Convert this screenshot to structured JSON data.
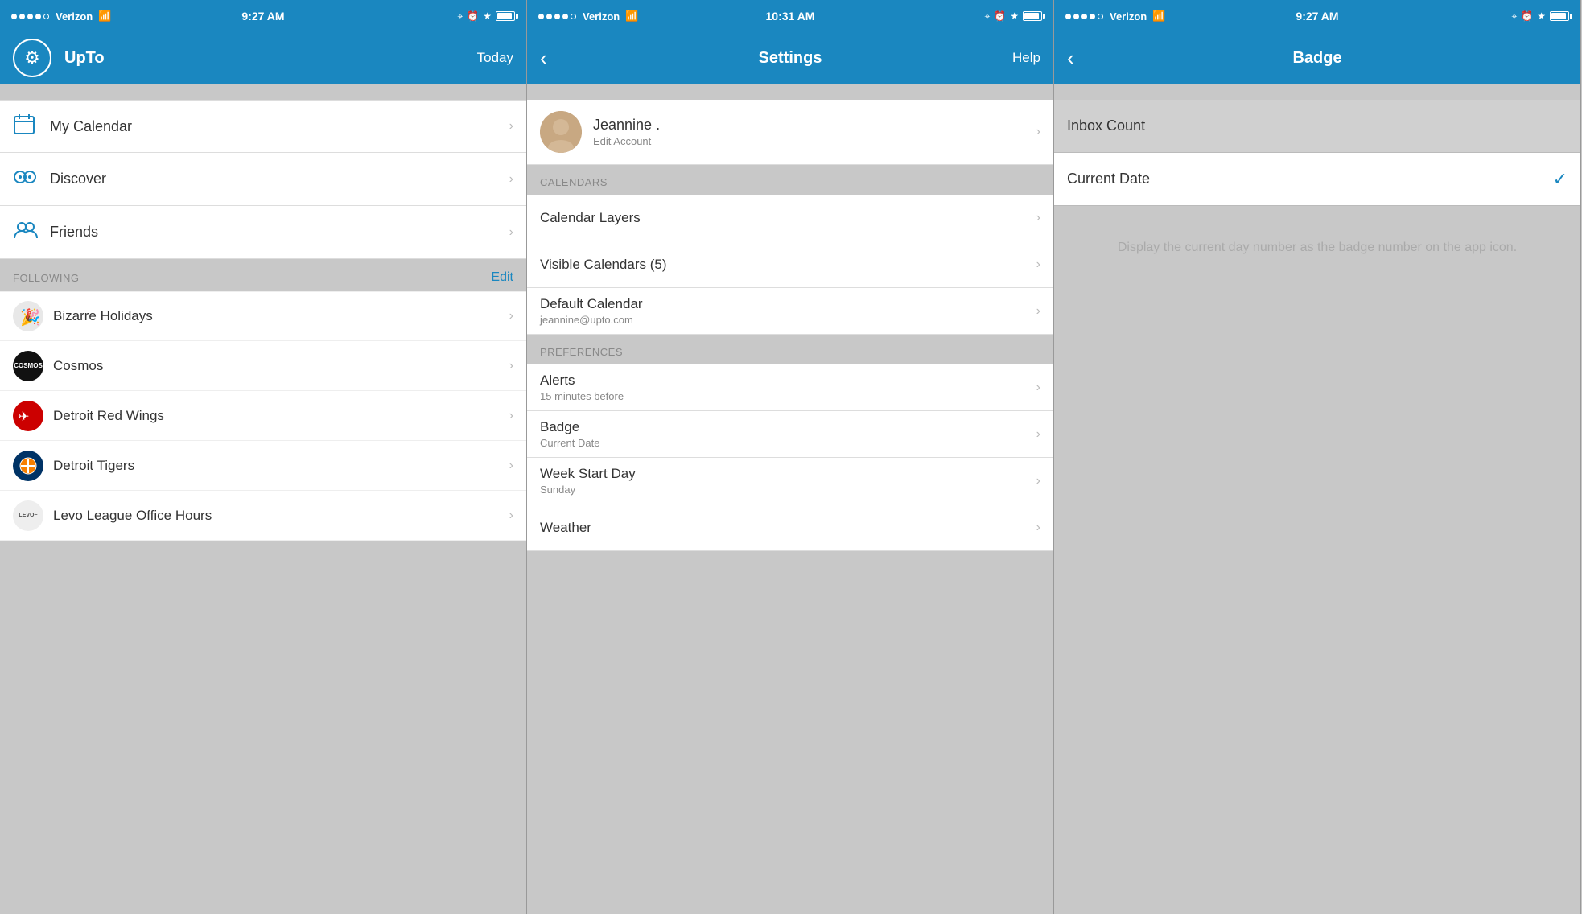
{
  "panel1": {
    "statusBar": {
      "carrier": "Verizon",
      "time": "9:27 AM",
      "dots": [
        true,
        true,
        true,
        true,
        true
      ],
      "dotsEmpty": [
        false
      ]
    },
    "navBar": {
      "title": "UpTo",
      "rightLabel": "Today",
      "gearIcon": "⚙"
    },
    "menuItems": [
      {
        "label": "My Calendar",
        "icon": "calendar"
      },
      {
        "label": "Discover",
        "icon": "discover"
      },
      {
        "label": "Friends",
        "icon": "friends"
      }
    ],
    "followingHeader": "FOLLOWING",
    "editLabel": "Edit",
    "followingItems": [
      {
        "label": "Bizarre Holidays",
        "avatarType": "holidays"
      },
      {
        "label": "Cosmos",
        "avatarType": "cosmos",
        "avatarText": "COSMOS"
      },
      {
        "label": "Detroit Red Wings",
        "avatarType": "detroit-rw"
      },
      {
        "label": "Detroit Tigers",
        "avatarType": "detroit-t"
      },
      {
        "label": "Levo League Office Hours",
        "avatarType": "levo",
        "avatarText": "LEVO"
      }
    ]
  },
  "panel2": {
    "statusBar": {
      "carrier": "Verizon",
      "time": "10:31 AM"
    },
    "navBar": {
      "title": "Settings",
      "rightLabel": "Help",
      "backIcon": "‹"
    },
    "user": {
      "name": "Jeannine .",
      "subLabel": "Edit Account"
    },
    "sections": [
      {
        "header": "CALENDARS",
        "items": [
          {
            "label": "Calendar Layers",
            "sub": ""
          },
          {
            "label": "Visible Calendars (5)",
            "sub": ""
          },
          {
            "label": "Default Calendar",
            "sub": "jeannine@upto.com"
          }
        ]
      },
      {
        "header": "PREFERENCES",
        "items": [
          {
            "label": "Alerts",
            "sub": "15 minutes before"
          },
          {
            "label": "Badge",
            "sub": "Current Date",
            "highlighted": true
          },
          {
            "label": "Week Start Day",
            "sub": "Sunday"
          },
          {
            "label": "Weather",
            "sub": ""
          }
        ]
      }
    ]
  },
  "panel3": {
    "statusBar": {
      "carrier": "Verizon",
      "time": "9:27 AM"
    },
    "navBar": {
      "title": "Badge",
      "backIcon": "‹"
    },
    "items": [
      {
        "label": "Inbox Count",
        "selected": false
      },
      {
        "label": "Current Date",
        "selected": true
      }
    ],
    "description": "Display the current day number\nas the badge number on the app icon."
  }
}
